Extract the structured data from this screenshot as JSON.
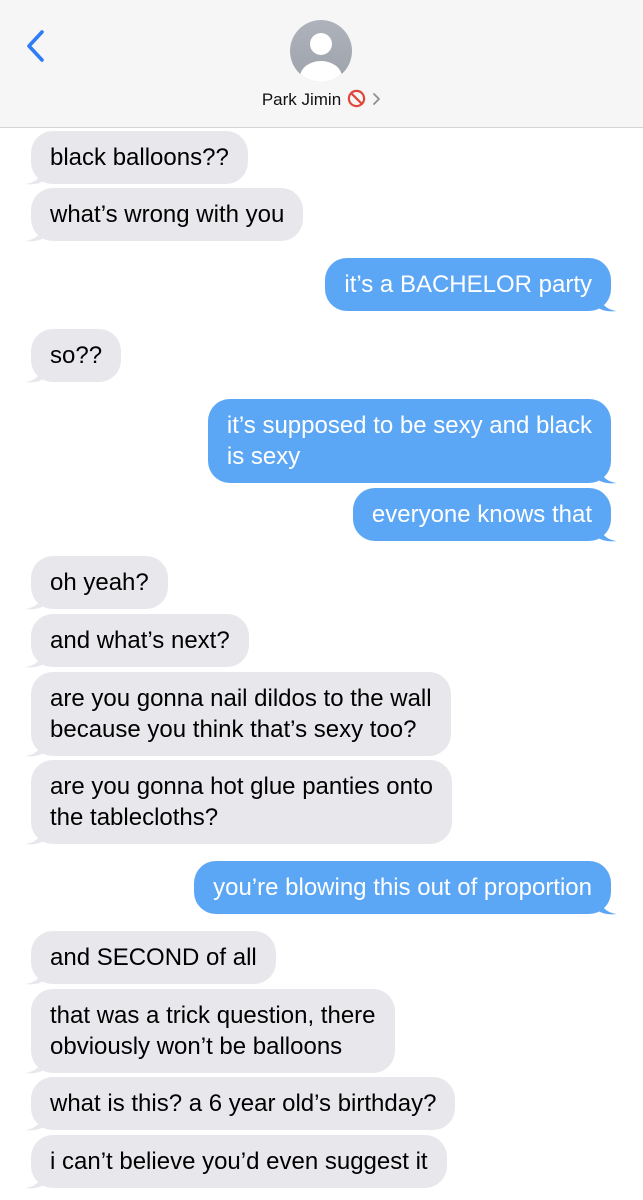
{
  "header": {
    "contact_name": "Park Jimin"
  },
  "colors": {
    "sent_bubble": "#5ca7f5",
    "received_bubble": "#e8e8ec",
    "accent": "#2f7df6",
    "blocked": "#e0463c"
  },
  "icons": {
    "back": "chevron-left-icon",
    "avatar": "person-silhouette-icon",
    "blocked": "blocked-icon",
    "disclosure": "chevron-right-icon"
  },
  "messages": [
    {
      "dir": "recv",
      "lines": [
        "black balloons??"
      ]
    },
    {
      "dir": "recv",
      "lines": [
        "what’s wrong with you"
      ]
    },
    {
      "dir": "sent",
      "lines": [
        "it’s a BACHELOR party"
      ]
    },
    {
      "dir": "recv",
      "lines": [
        "so??"
      ]
    },
    {
      "dir": "sent",
      "lines": [
        "it’s supposed to be sexy and black",
        "is sexy"
      ]
    },
    {
      "dir": "sent",
      "lines": [
        "everyone knows that"
      ]
    },
    {
      "dir": "recv",
      "lines": [
        "oh yeah?"
      ]
    },
    {
      "dir": "recv",
      "lines": [
        "and what’s next?"
      ]
    },
    {
      "dir": "recv",
      "lines": [
        "are you gonna nail dildos to the wall",
        "because you think that’s sexy too?"
      ]
    },
    {
      "dir": "recv",
      "lines": [
        "are you gonna hot glue panties onto",
        "the tablecloths?"
      ]
    },
    {
      "dir": "sent",
      "lines": [
        "you’re blowing this out of proportion"
      ]
    },
    {
      "dir": "recv",
      "lines": [
        "and SECOND of all"
      ]
    },
    {
      "dir": "recv",
      "lines": [
        "that was a trick question, there",
        "obviously won’t be balloons"
      ]
    },
    {
      "dir": "recv",
      "lines": [
        "what is this? a 6 year old’s birthday?"
      ]
    },
    {
      "dir": "recv",
      "lines": [
        "i can’t believe you’d even suggest it"
      ]
    }
  ]
}
